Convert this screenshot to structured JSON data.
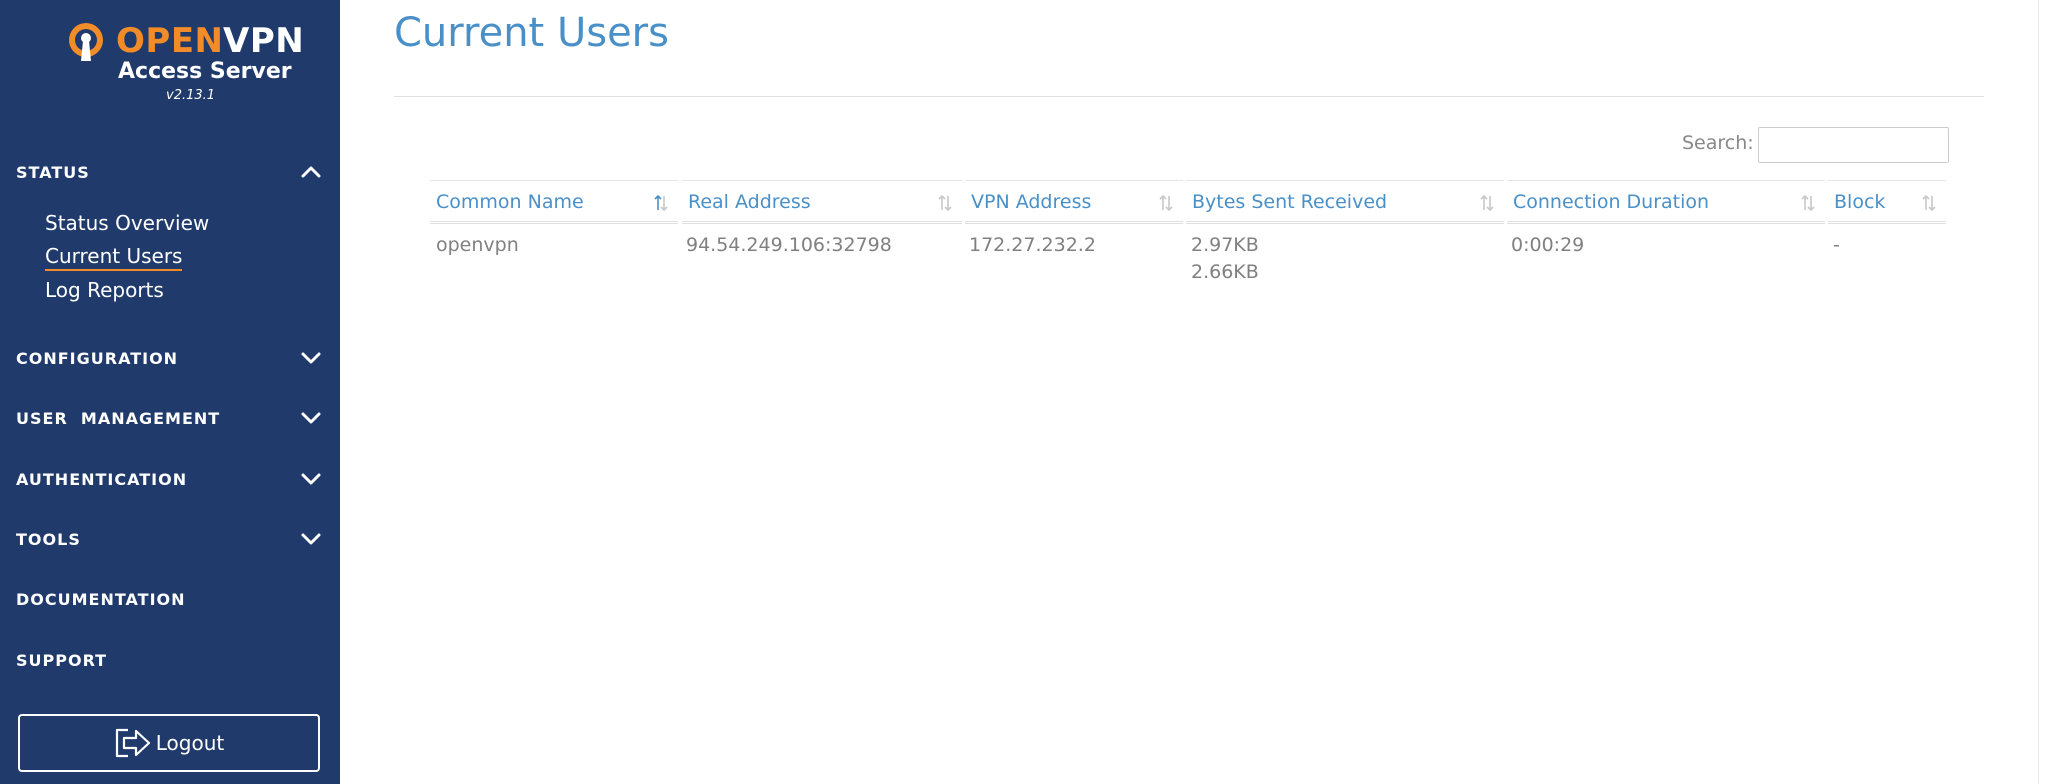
{
  "brand": {
    "name_part1": "OPEN",
    "name_part2": "VPN",
    "product": "Access Server",
    "version": "v2.13.1",
    "colors": {
      "orange": "#f28c28",
      "navy": "#1f3a6b",
      "accent_blue": "#4a90c8"
    }
  },
  "sidebar": {
    "sections": [
      {
        "label": "STATUS",
        "icon": "chevron-up-icon",
        "expanded": true,
        "items": [
          {
            "label": "Status Overview",
            "active": false
          },
          {
            "label": "Current Users",
            "active": true
          },
          {
            "label": "Log Reports",
            "active": false
          }
        ]
      },
      {
        "label": "CONFIGURATION",
        "icon": "chevron-down-icon"
      },
      {
        "label": "USER  MANAGEMENT",
        "icon": "chevron-down-icon"
      },
      {
        "label": "AUTHENTICATION",
        "icon": "chevron-down-icon"
      },
      {
        "label": "TOOLS",
        "icon": "chevron-down-icon"
      },
      {
        "label": "DOCUMENTATION"
      },
      {
        "label": "SUPPORT"
      }
    ],
    "logout_label": "Logout",
    "logout_icon": "logout-icon"
  },
  "main": {
    "title": "Current Users",
    "search_label": "Search:",
    "search_value": "",
    "table": {
      "columns": [
        {
          "label": "Common Name",
          "sort": "sorted-ascending"
        },
        {
          "label": "Real Address",
          "sort": "sortable"
        },
        {
          "label": "VPN Address",
          "sort": "sortable"
        },
        {
          "label": "Bytes Sent Received",
          "sort": "sortable"
        },
        {
          "label": "Connection Duration",
          "sort": "sortable"
        },
        {
          "label": "Block",
          "sort": "sortable"
        }
      ],
      "rows": [
        {
          "common_name": "openvpn",
          "real_address": "94.54.249.106:32798",
          "vpn_address": "172.27.232.2",
          "bytes_sent": "2.97KB",
          "bytes_received": "2.66KB",
          "connection_duration": "0:00:29",
          "block": "-"
        }
      ]
    }
  }
}
